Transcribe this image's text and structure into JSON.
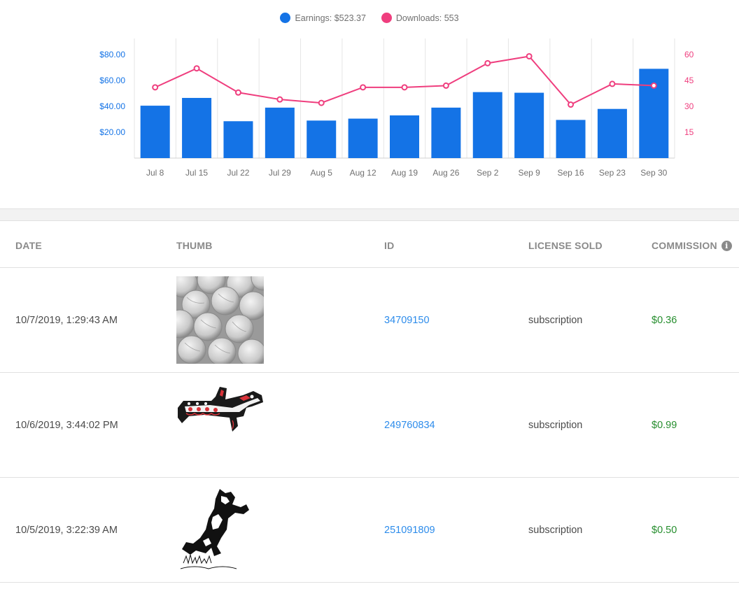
{
  "legend": {
    "earnings": "Earnings: $523.37",
    "downloads": "Downloads: 553"
  },
  "colors": {
    "earnings": "#1473e6",
    "downloads": "#ef3e7e",
    "commission": "#268e2e",
    "link": "#2d8ceb"
  },
  "chart_data": {
    "type": "bar",
    "categories": [
      "Jul 8",
      "Jul 15",
      "Jul 22",
      "Jul 29",
      "Aug 5",
      "Aug 12",
      "Aug 19",
      "Aug 26",
      "Sep 2",
      "Sep 9",
      "Sep 16",
      "Sep 23",
      "Sep 30"
    ],
    "series": [
      {
        "name": "Earnings: $523.37",
        "type": "bar",
        "axis": "left",
        "values": [
          40.5,
          46.5,
          28.5,
          39,
          29,
          30.5,
          33,
          39,
          51,
          50.5,
          29.5,
          38,
          69
        ]
      },
      {
        "name": "Downloads: 553",
        "type": "line",
        "axis": "right",
        "values": [
          41,
          52,
          38,
          34,
          32,
          41,
          41,
          42,
          55,
          59,
          31,
          43,
          42
        ]
      }
    ],
    "y_left": {
      "ticks": [
        "$20.00",
        "$40.00",
        "$60.00",
        "$80.00"
      ],
      "tick_values": [
        20,
        40,
        60,
        80
      ],
      "range": [
        0,
        80
      ]
    },
    "y_right": {
      "ticks": [
        "15",
        "30",
        "45",
        "60"
      ],
      "tick_values": [
        15,
        30,
        45,
        60
      ],
      "range": [
        0,
        60
      ]
    },
    "grid": "vertical",
    "legend_position": "top-center"
  },
  "table": {
    "headers": {
      "date": "DATE",
      "thumb": "THUMB",
      "id": "ID",
      "license": "LICENSE SOLD",
      "commission": "COMMISSION"
    },
    "rows": [
      {
        "date": "10/7/2019, 1:29:43 AM",
        "thumb": "volleyballs-thumbnail",
        "id": "34709150",
        "license": "subscription",
        "commission": "$0.36"
      },
      {
        "date": "10/6/2019, 3:44:02 PM",
        "thumb": "orca-totem-thumbnail",
        "id": "249760834",
        "license": "subscription",
        "commission": "$0.99"
      },
      {
        "date": "10/5/2019, 3:22:39 AM",
        "thumb": "leaping-wolf-thumbnail",
        "id": "251091809",
        "license": "subscription",
        "commission": "$0.50"
      }
    ]
  }
}
